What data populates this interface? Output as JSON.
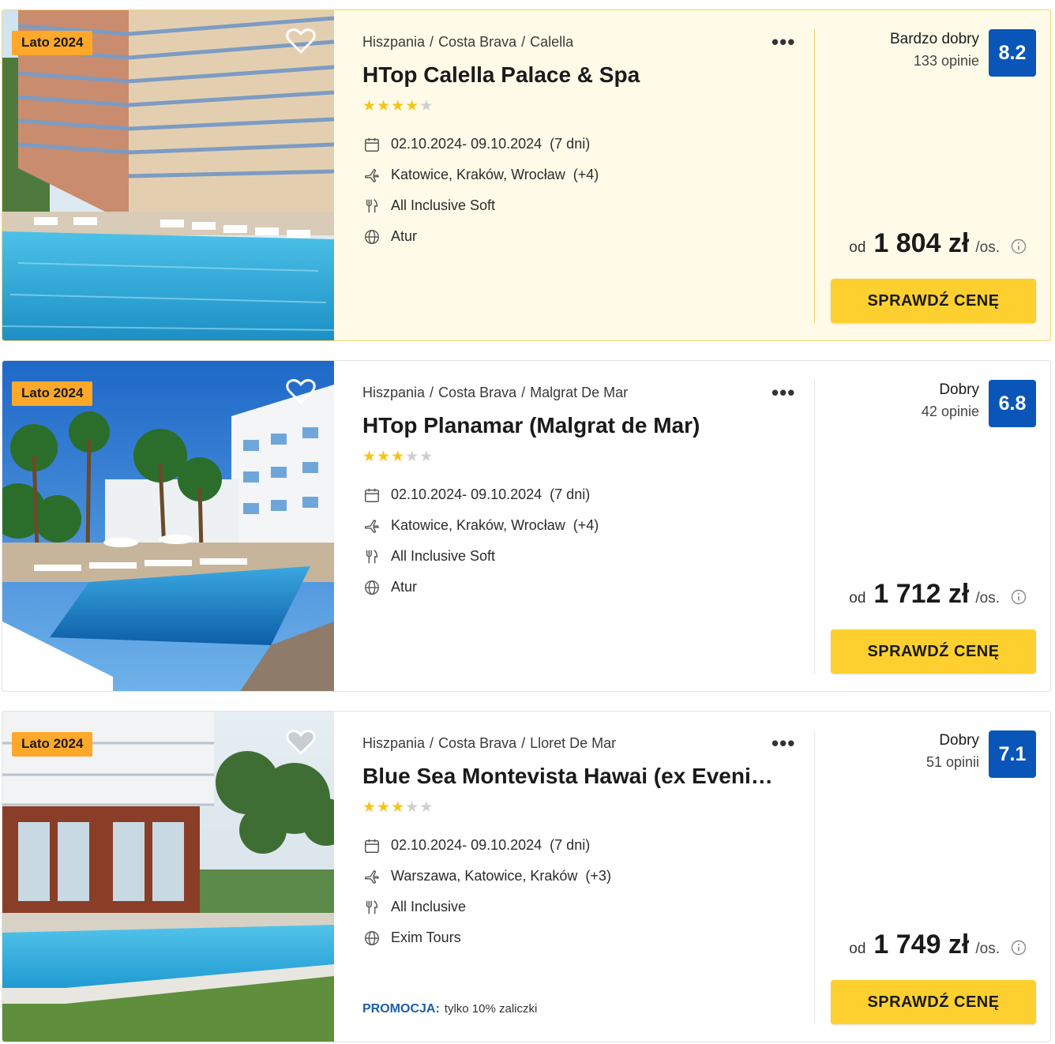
{
  "offers": [
    {
      "season": "Lato 2024",
      "location": [
        "Hiszpania",
        "Costa Brava",
        "Calella"
      ],
      "name": "HTop Calella Palace & Spa",
      "stars": 4,
      "dates": "02.10.2024- 09.10.2024",
      "duration": "(7 dni)",
      "airports": "Katowice, Kraków, Wrocław",
      "airports_extra": "(+4)",
      "board": "All Inclusive Soft",
      "operator": "Atur",
      "rating_label": "Bardzo dobry",
      "reviews": "133 opinie",
      "rating": "8.2",
      "price_prefix": "od",
      "price": "1 804 zł",
      "price_unit": "/os.",
      "cta": "SPRAWDŹ CENĘ",
      "highlighted": true
    },
    {
      "season": "Lato 2024",
      "location": [
        "Hiszpania",
        "Costa Brava",
        "Malgrat De Mar"
      ],
      "name": "HTop Planamar (Malgrat de Mar)",
      "stars": 3,
      "dates": "02.10.2024- 09.10.2024",
      "duration": "(7 dni)",
      "airports": "Katowice, Kraków, Wrocław",
      "airports_extra": "(+4)",
      "board": "All Inclusive Soft",
      "operator": "Atur",
      "rating_label": "Dobry",
      "reviews": "42 opinie",
      "rating": "6.8",
      "price_prefix": "od",
      "price": "1 712 zł",
      "price_unit": "/os.",
      "cta": "SPRAWDŹ CENĘ",
      "highlighted": false
    },
    {
      "season": "Lato 2024",
      "location": [
        "Hiszpania",
        "Costa Brava",
        "Lloret De Mar"
      ],
      "name": "Blue Sea Montevista Hawai (ex Eveni…",
      "stars": 3,
      "dates": "02.10.2024- 09.10.2024",
      "duration": "(7 dni)",
      "airports": "Warszawa, Katowice, Kraków",
      "airports_extra": "(+3)",
      "board": "All Inclusive",
      "operator": "Exim Tours",
      "rating_label": "Dobry",
      "reviews": "51 opinii",
      "rating": "7.1",
      "price_prefix": "od",
      "price": "1 749 zł",
      "price_unit": "/os.",
      "cta": "SPRAWDŹ CENĘ",
      "promo_label": "PROMOCJA:",
      "promo_text": "tylko 10% zaliczki",
      "highlighted": false
    }
  ],
  "icons": {
    "favorite": "heart-icon",
    "more": "more-dots-icon",
    "dates": "calendar-icon",
    "flights": "plane-icon",
    "board": "cutlery-icon",
    "operator": "globe-icon",
    "info": "info-icon"
  },
  "colors": {
    "season_badge": "#ffa82a",
    "rating_box": "#0a56b8",
    "cta": "#fed02f",
    "star": "#f5c518",
    "highlight_bg": "#fffbe8",
    "promo": "#1c5fa8"
  }
}
